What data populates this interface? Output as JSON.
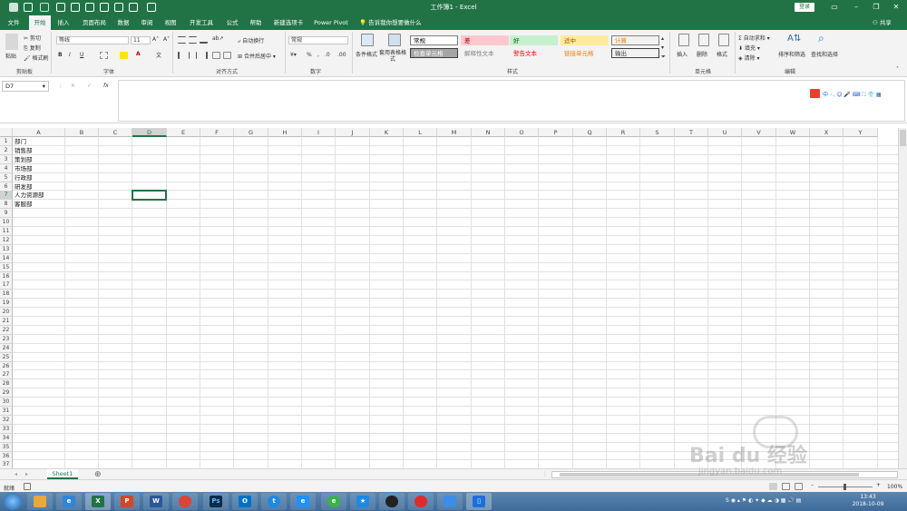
{
  "window": {
    "title": "工作簿1 - Excel",
    "login": "登录",
    "share": "共享"
  },
  "tabs": [
    "文件",
    "开始",
    "插入",
    "页面布局",
    "数据",
    "审阅",
    "视图",
    "开发工具",
    "公式",
    "帮助",
    "新建选项卡",
    "Power Pivot"
  ],
  "active_tab": "开始",
  "tell_me": "告诉我你想要做什么",
  "ribbon": {
    "clipboard": {
      "label": "剪贴板",
      "paste": "粘贴",
      "cut": "剪切",
      "copy": "复制",
      "format_painter": "格式刷"
    },
    "font": {
      "label": "字体",
      "name": "等线",
      "size": "11",
      "bold": "B",
      "italic": "I",
      "underline": "U"
    },
    "alignment": {
      "label": "对齐方式",
      "wrap": "自动换行",
      "merge": "合并后居中"
    },
    "number": {
      "label": "数字",
      "format": "常规",
      "percent": "%"
    },
    "styles": {
      "label": "样式",
      "conditional": "条件格式",
      "table_format": "套用表格格式",
      "cells": [
        {
          "text": "常规",
          "bg": "#ffffff",
          "fg": "#000000",
          "border": "#7f7f7f"
        },
        {
          "text": "差",
          "bg": "#ffc7ce",
          "fg": "#9c0006",
          "border": "#ffc7ce"
        },
        {
          "text": "好",
          "bg": "#c6efce",
          "fg": "#006100",
          "border": "#c6efce"
        },
        {
          "text": "适中",
          "bg": "#ffeb9c",
          "fg": "#9c5700",
          "border": "#ffeb9c"
        },
        {
          "text": "计算",
          "bg": "#f2f2f2",
          "fg": "#fa7d00",
          "border": "#7f7f7f"
        },
        {
          "text": "检查单元格",
          "bg": "#a5a5a5",
          "fg": "#ffffff",
          "border": "#3f3f3f"
        },
        {
          "text": "解释性文本",
          "bg": "#f3f3f3",
          "fg": "#7f7f7f",
          "border": "#f3f3f3"
        },
        {
          "text": "警告文本",
          "bg": "#f3f3f3",
          "fg": "#ff0000",
          "border": "#f3f3f3"
        },
        {
          "text": "链接单元格",
          "bg": "#f3f3f3",
          "fg": "#fa7d00",
          "border": "#f3f3f3"
        },
        {
          "text": "输出",
          "bg": "#f2f2f2",
          "fg": "#3f3f3f",
          "border": "#3f3f3f"
        }
      ]
    },
    "cells_group": {
      "label": "单元格",
      "insert": "插入",
      "delete": "删除",
      "format": "格式"
    },
    "editing": {
      "label": "编辑",
      "autosum": "自动求和",
      "fill": "填充",
      "clear": "清除",
      "sort": "排序和筛选",
      "find": "查找和选择"
    }
  },
  "formula_bar": {
    "name_box": "D7",
    "fx": "fx",
    "content": ""
  },
  "columns": [
    "A",
    "B",
    "C",
    "D",
    "E",
    "F",
    "G",
    "H",
    "I",
    "J",
    "K",
    "L",
    "M",
    "N",
    "O",
    "P",
    "Q",
    "R",
    "S",
    "T",
    "U",
    "V",
    "W",
    "X",
    "Y"
  ],
  "selected_column": "D",
  "rows": [
    "1",
    "2",
    "3",
    "4",
    "5",
    "6",
    "7",
    "8",
    "9",
    "10",
    "11",
    "12",
    "13",
    "14",
    "15",
    "16",
    "17",
    "18",
    "19",
    "20",
    "21",
    "22",
    "23",
    "24",
    "25",
    "26",
    "27",
    "28",
    "29",
    "30",
    "31",
    "32",
    "33",
    "34",
    "35",
    "36",
    "37"
  ],
  "selected_row": "7",
  "cells": {
    "A1": "部门",
    "A2": "销售部",
    "A3": "策划部",
    "A4": "市场部",
    "A5": "行政部",
    "A6": "研发部",
    "A7": "人力资源部",
    "A8": "客服部"
  },
  "sheet_tab": "Sheet1",
  "status": {
    "ready": "就绪",
    "zoom": "100%"
  },
  "clock": {
    "time": "13:43",
    "date": "2018-10-09"
  },
  "watermark": {
    "brand": "Bai du 经验",
    "url": "jingyan.baidu.com"
  },
  "accent": "#217346"
}
